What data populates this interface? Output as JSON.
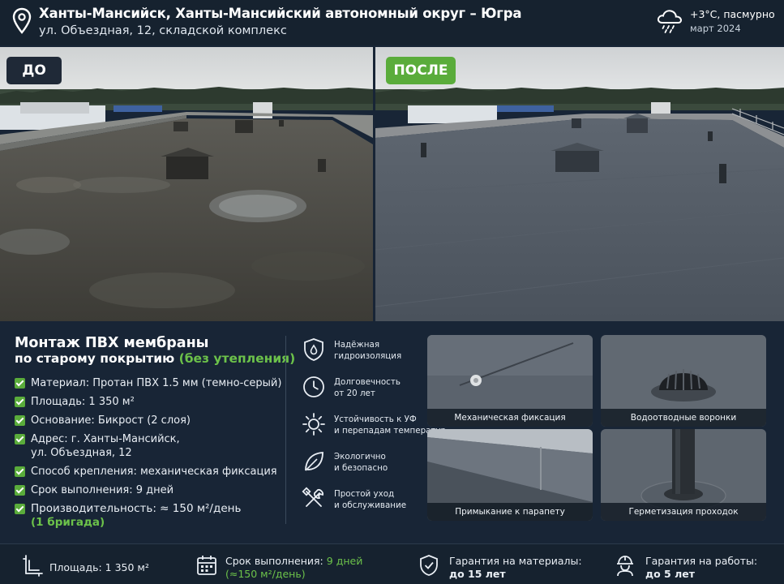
{
  "header": {
    "location_title": "Ханты-Мансийск, Ханты-Мансийский автономный округ – Югра",
    "address": "ул. Объездная, 12, складской комплекс",
    "weather_icon": "cloud-snow-icon",
    "temperature": "+3°C, пасмурно",
    "date": "март 2024"
  },
  "photos": {
    "before_label": "ДО",
    "after_label": "ПОСЛЕ"
  },
  "info": {
    "title_line1": "Монтаж ПВХ мембраны",
    "title_line2": "по старому покрытию",
    "title_highlight": "(без утепления)",
    "facts": [
      {
        "text": "Материал: Протан ПВХ 1.5 мм (темно-серый)"
      },
      {
        "text": "Площадь: 1 350 м²"
      },
      {
        "text": "Основание: Бикрост (2 слоя)"
      },
      {
        "line1": "Адрес: г. Ханты-Мансийск,",
        "line2": "ул. Объездная, 12"
      },
      {
        "text": "Способ крепления: механическая фиксация"
      },
      {
        "text": "Срок выполнения: 9 дней"
      },
      {
        "line1": "Производительность: ≈ 150 м²/день",
        "line2": "(1 бригада)"
      }
    ],
    "features": [
      {
        "icon": "water-shield-icon",
        "line1": "Надёжная",
        "line2": "гидроизоляция"
      },
      {
        "icon": "clock-icon",
        "line1": "Долговечность",
        "line2": "от 20 лет"
      },
      {
        "icon": "sun-icon",
        "line1": "Устойчивость к УФ",
        "line2": "и перепадам температур"
      },
      {
        "icon": "leaf-icon",
        "line1": "Экологично",
        "line2": "и безопасно"
      },
      {
        "icon": "tools-icon",
        "line1": "Простой уход",
        "line2": "и обслуживание"
      }
    ],
    "tiles": [
      {
        "caption": "Механическая фиксация"
      },
      {
        "caption": "Водоотводные воронки"
      },
      {
        "caption": "Примыкание к парапету"
      },
      {
        "caption": "Герметизация проходок"
      }
    ]
  },
  "bottom": {
    "area": "Площадь: 1 350 м²",
    "duration_label": "Срок выполнения:",
    "duration_value": "9 дней",
    "duration_rate": "(≈150 м²/день)",
    "materials_label": "Гарантия на материалы:",
    "materials_value": "до 15 лет",
    "works_label": "Гарантия на работы:",
    "works_value": "до 5 лет"
  },
  "colors": {
    "background": "#182536",
    "accent_green": "#5aac3b",
    "highlight_green": "#6cc24a"
  }
}
